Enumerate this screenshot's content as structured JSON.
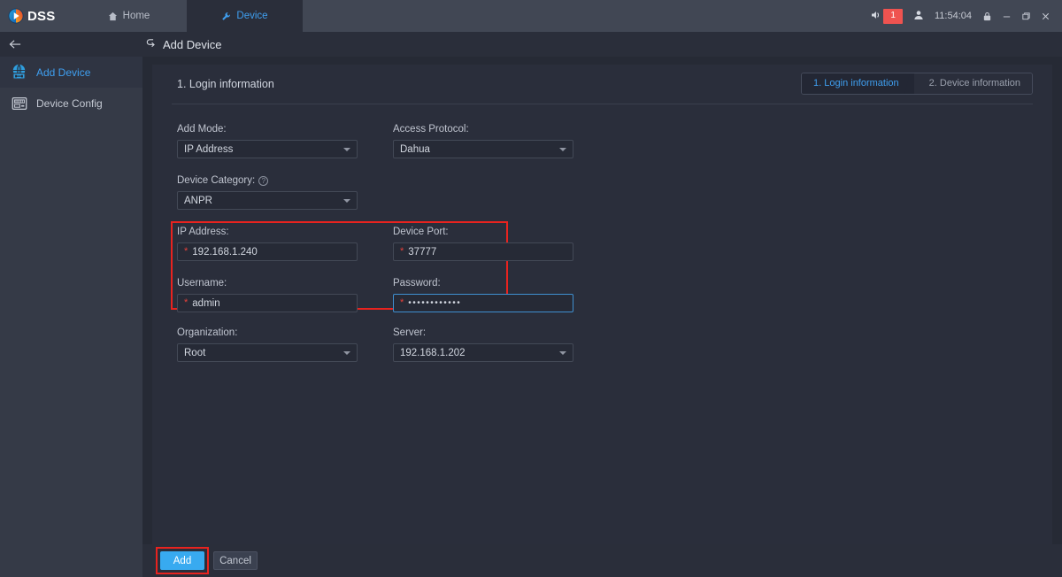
{
  "app": {
    "brand": "DSS",
    "logo_icon": "dss-play-logo-icon"
  },
  "topbar": {
    "tabs": [
      {
        "label": "Home",
        "icon": "home-icon",
        "active": false
      },
      {
        "label": "Device",
        "icon": "wrench-icon",
        "active": true
      }
    ],
    "status": {
      "alarm_icon": "speaker-alarm-icon",
      "alarm_count": "1",
      "user_icon": "user-icon",
      "time": "11:54:04",
      "lock_icon": "lock-icon",
      "minimize": "minimize-icon",
      "restore": "restore-icon",
      "close": "close-icon"
    },
    "accent": "#3f9ff0",
    "alarm_color": "#ef5350"
  },
  "breadcrumb": {
    "back_icon": "back-arrow-icon",
    "return_icon": "return-arrow-icon",
    "title": "Add Device"
  },
  "sidebar": {
    "items": [
      {
        "label": "Add Device",
        "icon": "add-device-icon",
        "active": true
      },
      {
        "label": "Device Config",
        "icon": "device-config-icon",
        "active": false
      }
    ]
  },
  "panel": {
    "title": "1. Login information",
    "steps": [
      {
        "label": "1. Login information",
        "active": true
      },
      {
        "label": "2. Device information",
        "active": false
      }
    ]
  },
  "form": {
    "add_mode": {
      "label": "Add Mode:",
      "value": "IP Address",
      "type": "select"
    },
    "access_protocol": {
      "label": "Access Protocol:",
      "value": "Dahua",
      "type": "select"
    },
    "device_category": {
      "label": "Device Category:",
      "value": "ANPR",
      "type": "select",
      "help_icon": "help-circle-icon"
    },
    "ip_address": {
      "label": "IP Address:",
      "value": "192.168.1.240",
      "required": "*",
      "type": "text"
    },
    "device_port": {
      "label": "Device Port:",
      "value": "37777",
      "required": "*",
      "type": "text"
    },
    "username": {
      "label": "Username:",
      "value": "admin",
      "required": "*",
      "type": "text"
    },
    "password": {
      "label": "Password:",
      "value": "••••••••••••",
      "required": "*",
      "type": "password",
      "focused": true
    },
    "organization": {
      "label": "Organization:",
      "value": "Root",
      "type": "select"
    },
    "server": {
      "label": "Server:",
      "value": "192.168.1.202",
      "type": "select"
    }
  },
  "footer": {
    "add_label": "Add",
    "cancel_label": "Cancel"
  },
  "highlights": {
    "color": "#e8231f",
    "credentials_box": true,
    "add_button_box": true
  }
}
